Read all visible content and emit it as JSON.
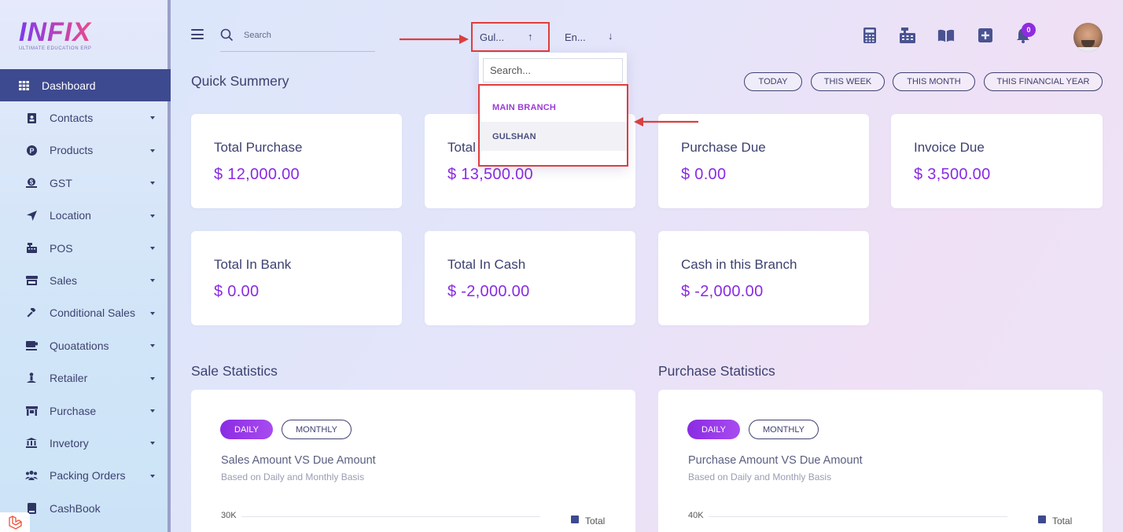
{
  "logo": {
    "main": "INFIX",
    "sub": "ULTIMATE EDUCATION ERP"
  },
  "sidebar": {
    "items": [
      {
        "label": "Dashboard",
        "icon": "grid-icon",
        "active": true,
        "caret": false
      },
      {
        "label": "Contacts",
        "icon": "address-book-icon",
        "caret": true
      },
      {
        "label": "Products",
        "icon": "product-icon",
        "caret": true
      },
      {
        "label": "GST",
        "icon": "tax-icon",
        "caret": true
      },
      {
        "label": "Location",
        "icon": "location-arrow-icon",
        "caret": true
      },
      {
        "label": "POS",
        "icon": "cash-register-icon",
        "caret": true
      },
      {
        "label": "Sales",
        "icon": "store-icon",
        "caret": true
      },
      {
        "label": "Conditional Sales",
        "icon": "gavel-icon",
        "caret": true
      },
      {
        "label": "Quoatations",
        "icon": "coffee-icon",
        "caret": true
      },
      {
        "label": "Retailer",
        "icon": "person-icon",
        "caret": true
      },
      {
        "label": "Purchase",
        "icon": "shop-icon",
        "caret": true
      },
      {
        "label": "Invetory",
        "icon": "bank-icon",
        "caret": true
      },
      {
        "label": "Packing Orders",
        "icon": "users-icon",
        "caret": true
      },
      {
        "label": "CashBook",
        "icon": "book-icon",
        "caret": false
      }
    ]
  },
  "header": {
    "search_placeholder": "Search",
    "branch_select": "Gul...",
    "language_select": "En...",
    "notification_count": "0"
  },
  "branch_dropdown": {
    "search_placeholder": "Search...",
    "options": [
      "MAIN BRANCH",
      "GULSHAN"
    ]
  },
  "summary": {
    "title": "Quick Summery",
    "filters": [
      "TODAY",
      "THIS WEEK",
      "THIS MONTH",
      "THIS FINANCIAL YEAR"
    ],
    "cards": [
      {
        "label": "Total Purchase",
        "value": "$ 12,000.00"
      },
      {
        "label": "Total",
        "value": "$ 13,500.00"
      },
      {
        "label": "Purchase Due",
        "value": "$ 0.00"
      },
      {
        "label": "Invoice Due",
        "value": "$ 3,500.00"
      },
      {
        "label": "Total In Bank",
        "value": "$ 0.00"
      },
      {
        "label": "Total In Cash",
        "value": "$ -2,000.00"
      },
      {
        "label": "Cash in this Branch",
        "value": "$ -2,000.00"
      }
    ]
  },
  "sale_stats": {
    "title": "Sale Statistics",
    "tabs": [
      "DAILY",
      "MONTHLY"
    ],
    "chart_title": "Sales Amount VS Due Amount",
    "chart_subtitle": "Based on Daily and Monthly Basis",
    "axis_top": "30K",
    "legend": "Total"
  },
  "purchase_stats": {
    "title": "Purchase Statistics",
    "tabs": [
      "DAILY",
      "MONTHLY"
    ],
    "chart_title": "Purchase Amount VS Due Amount",
    "chart_subtitle": "Based on Daily and Monthly Basis",
    "axis_top": "40K",
    "legend": "Total"
  },
  "colors": {
    "accent": "#8a2be2",
    "sidebar_active": "#3e4a8f",
    "highlight": "#e03d3d"
  }
}
